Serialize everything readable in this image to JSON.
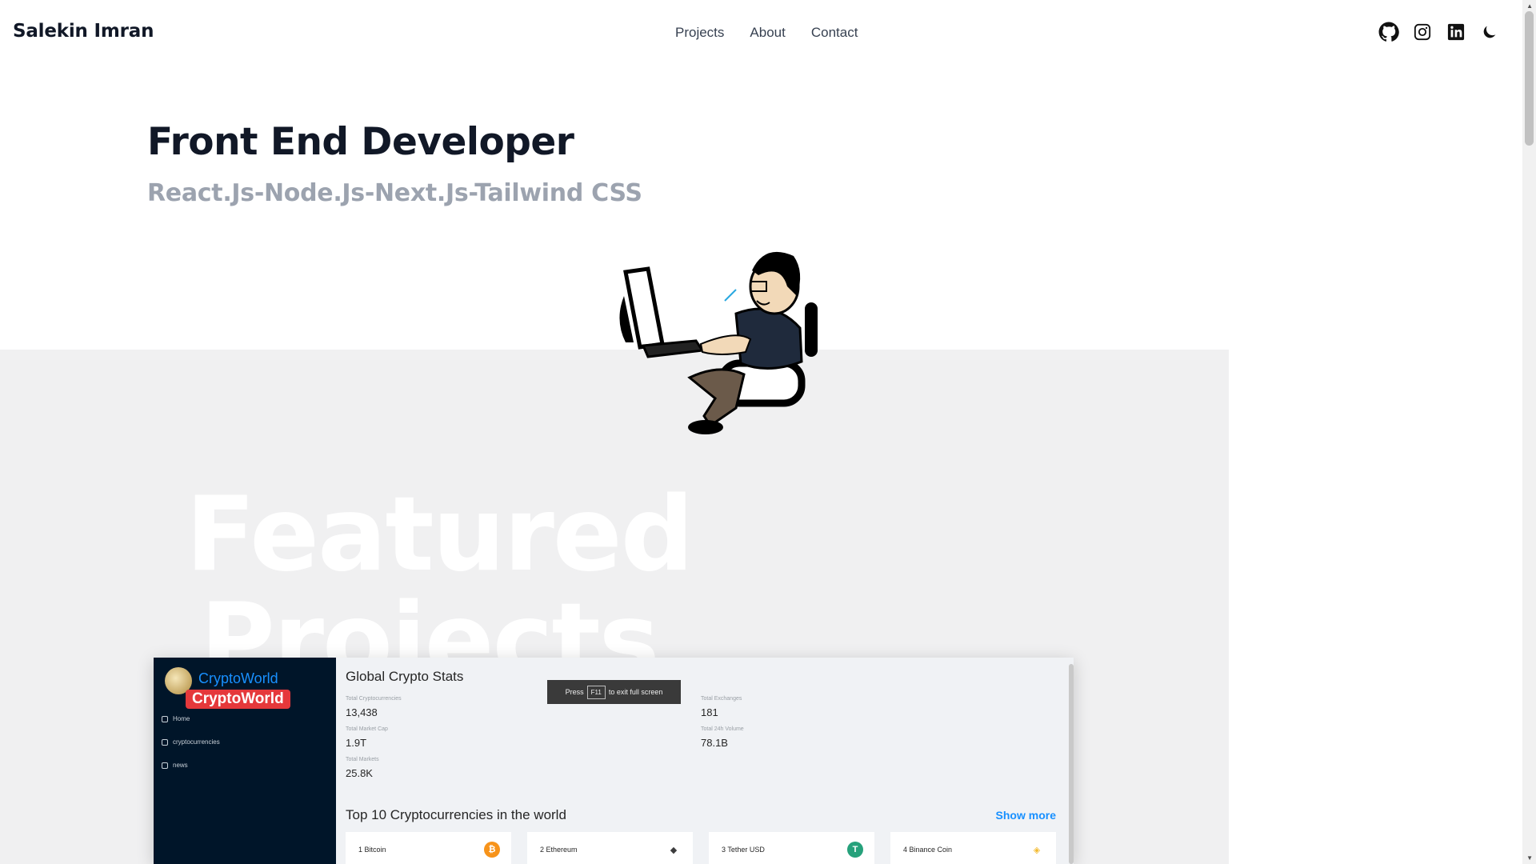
{
  "header": {
    "brand": "Salekin Imran",
    "nav": [
      "Projects",
      "About",
      "Contact"
    ],
    "social_icons": [
      "github-icon",
      "instagram-icon",
      "linkedin-icon",
      "moon-icon"
    ]
  },
  "hero": {
    "title": "Front End Developer",
    "subtitle": "React.Js-Node.Js-Next.Js-Tailwind CSS"
  },
  "featured": {
    "line1": "Featured",
    "line2": "Projects"
  },
  "project": {
    "app_name": "CryptoWorld",
    "badge": "CryptoWorld",
    "menu": [
      "Home",
      "cryptocurrencies",
      "news"
    ],
    "stats_title": "Global Crypto Stats",
    "fullscreen_hint": {
      "pre": "Press",
      "key": "F11",
      "post": "to exit full screen"
    },
    "stats": [
      {
        "label": "Total Cryptocurrencies",
        "value": "13,438"
      },
      {
        "label": "Total Market Cap",
        "value": "1.9T"
      },
      {
        "label": "Total Markets",
        "value": "25.8K"
      },
      {
        "label": "Total Exchanges",
        "value": "181"
      },
      {
        "label": "Total 24h Volume",
        "value": "78.1B"
      }
    ],
    "top10_title": "Top 10 Cryptocurrencies in the world",
    "show_more": "Show more",
    "coins": [
      {
        "name": "1 Bitcoin",
        "color": "#f7931a",
        "symbol": "₿"
      },
      {
        "name": "2 Ethereum",
        "color": "#3c3c3d",
        "symbol": "◆"
      },
      {
        "name": "3 Tether USD",
        "color": "#26a17b",
        "symbol": "T"
      },
      {
        "name": "4 Binance Coin",
        "color": "#f3ba2f",
        "symbol": "◈"
      }
    ]
  },
  "colors": {
    "accent": "#1890ff",
    "sidebar": "#001529",
    "badge": "#e5383b"
  }
}
